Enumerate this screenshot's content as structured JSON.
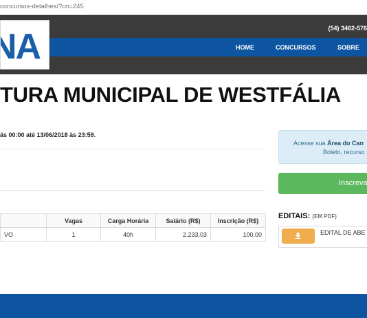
{
  "browser": {
    "url": "concursos-detalhes/?cn=245"
  },
  "header": {
    "phone": "(54) 3462-576",
    "logo_text": "NA",
    "nav": [
      "HOME",
      "CONCURSOS",
      "SOBRE"
    ]
  },
  "page": {
    "title": "TURA MUNICIPAL DE WESTFÁLIA",
    "period": "ás 00:00 até 13/06/2018 às 23:59."
  },
  "table": {
    "headers": [
      "",
      "Vagas",
      "Carga Horária",
      "Salário (R$)",
      "Inscrição (R$)"
    ],
    "rows": [
      [
        "VO",
        "1",
        "40h",
        "2.233,03",
        "100,00"
      ]
    ]
  },
  "sidebar": {
    "area_text_prefix": "Acesse sua ",
    "area_text_bold": "Área do Can",
    "area_text_line2": "Boleto, recurso",
    "register_button": "Inscreva",
    "editais_title": "EDITAIS:",
    "editais_note": "(EM PDF)",
    "edital_items": [
      "EDITAL DE ABE"
    ]
  },
  "colors": {
    "nav_blue": "#0d55a1",
    "dark_bar": "#3b3b3b",
    "success_green": "#5cb85c",
    "warning_orange": "#f0ad4e",
    "info_bg": "#dcedf7"
  },
  "icons": {
    "download": "download-icon"
  }
}
